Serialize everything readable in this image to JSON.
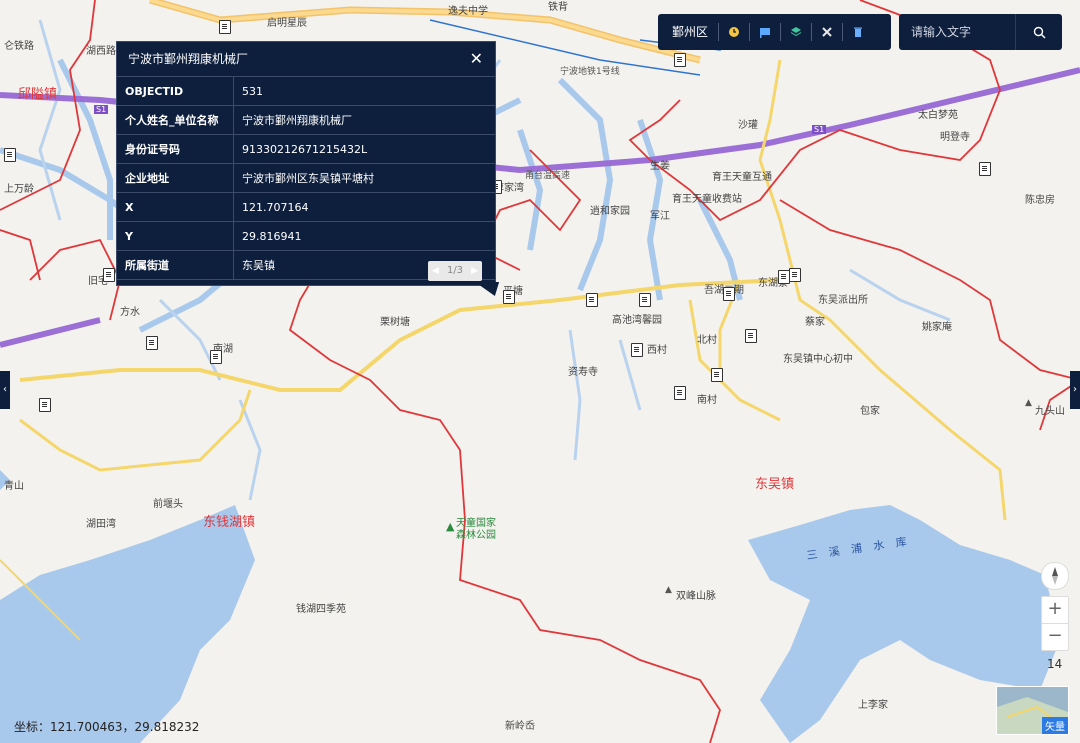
{
  "toolbar": {
    "district": "鄞州区",
    "tools": [
      {
        "icon": "clock-icon",
        "color": "#f4c542"
      },
      {
        "icon": "flag-icon",
        "color": "#5aa9ff"
      },
      {
        "icon": "layers-icon",
        "color": "#3fc7a0"
      },
      {
        "icon": "tools-icon",
        "color": "#e8e8e8"
      },
      {
        "icon": "trash-icon",
        "color": "#6ab0ff"
      }
    ]
  },
  "search": {
    "placeholder": "请输入文字"
  },
  "popup": {
    "title": "宁波市鄞州翔康机械厂",
    "close": "✕",
    "rows": [
      {
        "key": "OBJECTID",
        "value": "531"
      },
      {
        "key": "个人姓名_单位名称",
        "value": "宁波市鄞州翔康机械厂"
      },
      {
        "key": "身份证号码",
        "value": "91330212671215432L"
      },
      {
        "key": "企业地址",
        "value": "宁波市鄞州区东吴镇平塘村"
      },
      {
        "key": "X",
        "value": "121.707164"
      },
      {
        "key": "Y",
        "value": "29.816941"
      },
      {
        "key": "所属街道",
        "value": "东吴镇"
      }
    ],
    "pager": "1/3"
  },
  "map_labels": {
    "towns": [
      "邱隘镇",
      "东钱湖镇",
      "东吴镇"
    ],
    "places": [
      "启明星辰",
      "逸夫中学",
      "铁背",
      "仑铁路",
      "湖西路",
      "上万龄",
      "旧宅",
      "方水",
      "南湖",
      "青山",
      "前堰头",
      "湖田湾",
      "钱湖四季苑",
      "新岭岙",
      "生姜",
      "育王天童收费站",
      "育王天童互通",
      "逍和家园",
      "军江",
      "沙瓘",
      "太白梦苑",
      "明登寺",
      "陈忠房",
      "东湖景",
      "吾湖二期",
      "东吴派出所",
      "蔡家",
      "姚家庵",
      "西村",
      "北村",
      "南村",
      "东吴镇中心初中",
      "资寿寺",
      "包家",
      "九头山",
      "双峰山脉",
      "上李家",
      "平塘",
      "栗树塘",
      "高池湾馨园",
      "淳家湾",
      "宁波地铁1号线",
      "甬台温高速"
    ],
    "roads": [
      "S1"
    ],
    "water": "三 溪 浦 水 库",
    "park": "天童国家森林公园"
  },
  "controls": {
    "zoom_in": "+",
    "zoom_out": "−",
    "zoom_level": "14",
    "minimap_label": "矢量",
    "left_arrow": "‹",
    "right_arrow": "›"
  },
  "coordinates": "坐标：121.700463，29.818232"
}
